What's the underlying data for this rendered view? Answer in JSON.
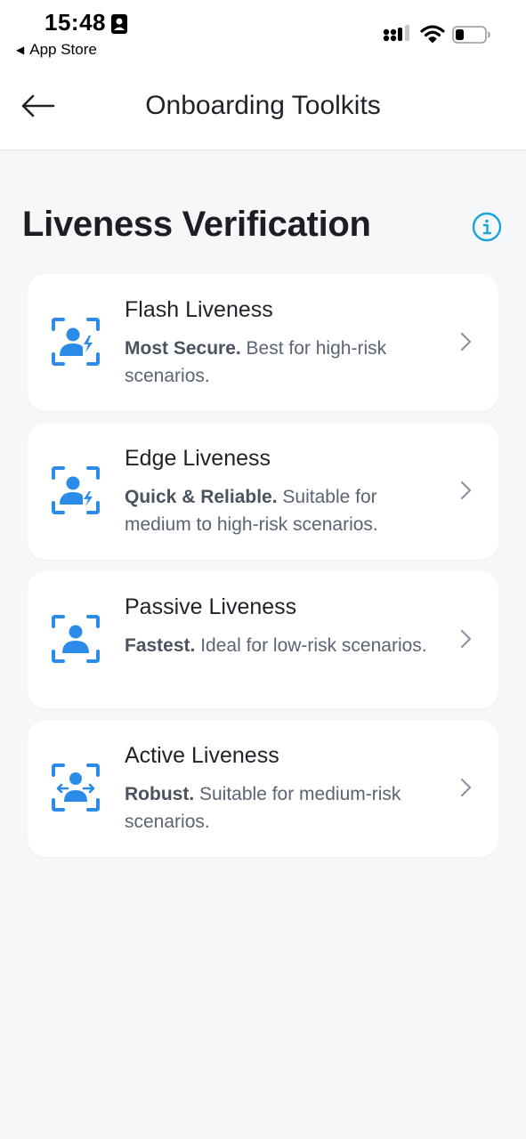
{
  "status_bar": {
    "time": "15:48",
    "back_app_label": "App Store"
  },
  "header": {
    "title": "Onboarding Toolkits"
  },
  "section": {
    "title": "Liveness Verification"
  },
  "colors": {
    "accent": "#2b8be8",
    "info": "#1aa3d9"
  },
  "cards": [
    {
      "title": "Flash Liveness",
      "desc_bold": "Most Secure.",
      "desc_rest": " Best for high-risk scenarios.",
      "icon": "face-scan-lightning-icon"
    },
    {
      "title": "Edge Liveness",
      "desc_bold": "Quick & Reliable.",
      "desc_rest": " Suitable for medium to high-risk scenarios.",
      "icon": "face-scan-lightning-icon"
    },
    {
      "title": "Passive Liveness",
      "desc_bold": "Fastest.",
      "desc_rest": " Ideal for low-risk scenarios.",
      "icon": "face-scan-icon"
    },
    {
      "title": "Active Liveness",
      "desc_bold": "Robust.",
      "desc_rest": " Suitable for medium-risk scenarios.",
      "icon": "face-scan-arrows-icon"
    }
  ]
}
